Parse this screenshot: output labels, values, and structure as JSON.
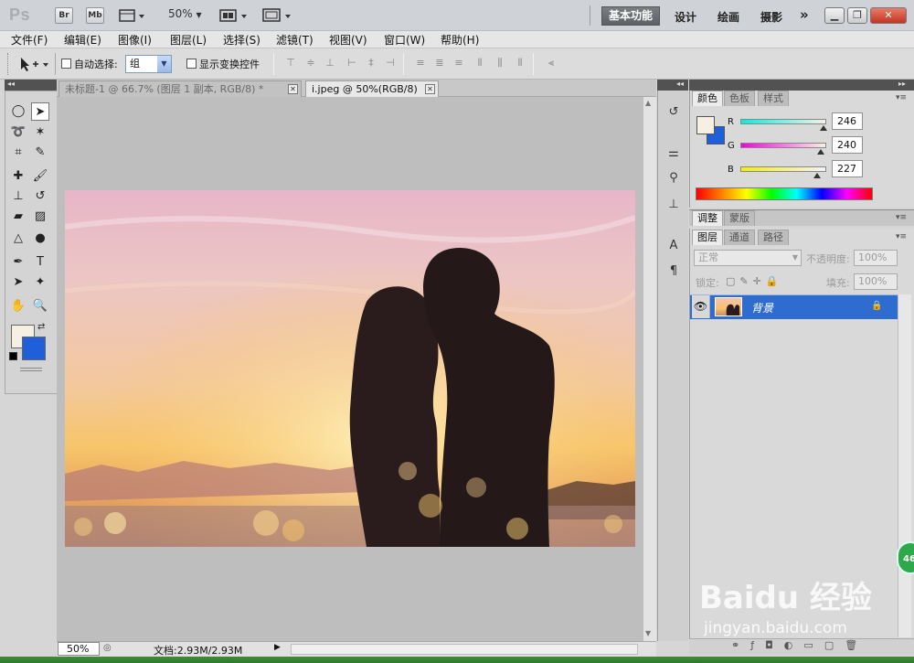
{
  "appbar": {
    "logo": "Ps",
    "bridge": "Br",
    "mini_bridge": "Mb",
    "zoom": "50%",
    "workspaces": [
      "基本功能",
      "设计",
      "绘画",
      "摄影"
    ],
    "more": "»"
  },
  "menus": [
    "文件(F)",
    "编辑(E)",
    "图像(I)",
    "图层(L)",
    "选择(S)",
    "滤镜(T)",
    "视图(V)",
    "窗口(W)",
    "帮助(H)"
  ],
  "options": {
    "auto_select_label": "自动选择:",
    "auto_select_value": "组",
    "show_transform_label": "显示变换控件"
  },
  "documents": [
    {
      "title": "未标题-1 @ 66.7% (图层 1 副本, RGB/8) *",
      "active": false
    },
    {
      "title": "i.jpeg @ 50%(RGB/8)",
      "active": true
    }
  ],
  "color_panel": {
    "tabs": [
      "颜色",
      "色板",
      "样式"
    ],
    "r_label": "R",
    "g_label": "G",
    "b_label": "B",
    "r": "246",
    "g": "240",
    "b": "227",
    "r_fraction": 0.965,
    "g_fraction": 0.941,
    "b_fraction": 0.89,
    "foreground": "#f6f0e3",
    "background": "#1f5fd9"
  },
  "adjust_tabs": [
    "调整",
    "蒙版"
  ],
  "layers_panel": {
    "tabs": [
      "图层",
      "通道",
      "路径"
    ],
    "blend_mode": "正常",
    "opacity_label": "不透明度:",
    "opacity_value": "100%",
    "lock_label": "锁定:",
    "fill_label": "填充:",
    "fill_value": "100%",
    "layers": [
      {
        "name": "背景",
        "locked": true,
        "visible": true,
        "selected": true
      }
    ]
  },
  "statusbar": {
    "zoom": "50%",
    "doc_size": "文档:2.93M/2.93M"
  },
  "watermark": {
    "badge": "46",
    "brand": "Baidu 经验",
    "url": "jingyan.baidu.com"
  }
}
